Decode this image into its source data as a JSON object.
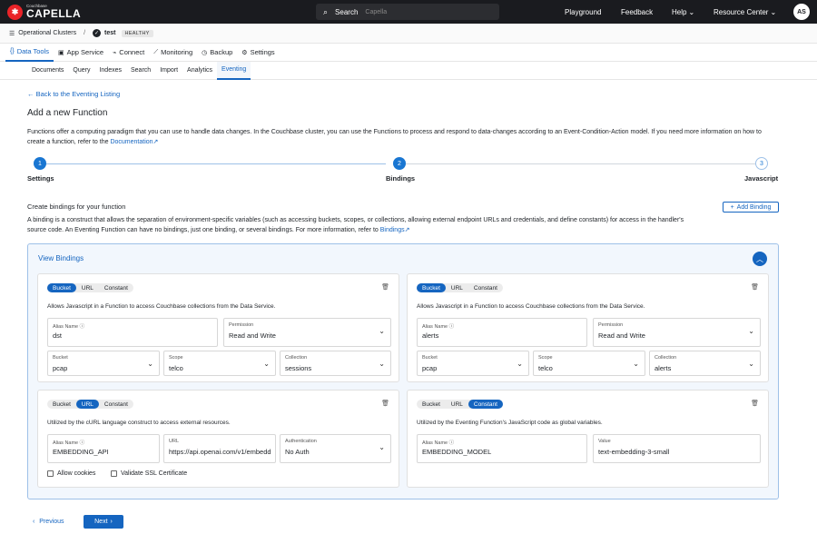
{
  "topbar": {
    "brand_small": "Couchbase",
    "brand": "CAPELLA",
    "search_label": "Search",
    "search_placeholder": "Capella",
    "nav": [
      "Playground",
      "Feedback",
      "Help",
      "Resource Center"
    ],
    "avatar": "AS"
  },
  "breadcrumb": {
    "root": "Operational Clusters",
    "separator": "/",
    "cluster": "test",
    "status": "HEALTHY"
  },
  "main_tabs": [
    "Data Tools",
    "App Service",
    "Connect",
    "Monitoring",
    "Backup",
    "Settings"
  ],
  "sub_tabs": [
    "Documents",
    "Query",
    "Indexes",
    "Search",
    "Import",
    "Analytics",
    "Eventing"
  ],
  "page": {
    "back": "Back to the Eventing Listing",
    "title": "Add a new Function",
    "intro": "Functions offer a computing paradigm that you can use to handle data changes. In the Couchbase cluster, you can use the Functions to process and respond to data-changes according to an Event-Condition-Action model. If you need more information on how to create a function, refer to the ",
    "intro_link": "Documentation"
  },
  "stepper": [
    {
      "num": "1",
      "label": "Settings"
    },
    {
      "num": "2",
      "label": "Bindings"
    },
    {
      "num": "3",
      "label": "Javascript"
    }
  ],
  "bindings": {
    "title": "Create bindings for your function",
    "add": "Add Binding",
    "desc": "A binding is a construct that allows the separation of environment-specific variables (such as accessing buckets, scopes, or collections, allowing external endpoint URLs and credentials, and define constants) for access in the handler's source code. An Eventing Function can have no bindings, just one binding, or several bindings. For more information, refer to ",
    "desc_link": "Bindings",
    "panel_title": "View Bindings",
    "seg": [
      "Bucket",
      "URL",
      "Constant"
    ],
    "bucket_desc": "Allows Javascript in a Function to access Couchbase collections from the Data Service.",
    "url_desc": "Utilized by the cURL language construct to access external resources.",
    "const_desc": "Utilized by the Eventing Function's JavaScript code as global variables.",
    "labels": {
      "alias": "Alias Name",
      "permission": "Permission",
      "bucket": "Bucket",
      "scope": "Scope",
      "collection": "Collection",
      "url": "URL",
      "auth": "Authentication",
      "value": "Value"
    },
    "b1": {
      "alias": "dst",
      "permission": "Read and Write",
      "bucket": "pcap",
      "scope": "telco",
      "collection": "sessions"
    },
    "b2": {
      "alias": "alerts",
      "permission": "Read and Write",
      "bucket": "pcap",
      "scope": "telco",
      "collection": "alerts"
    },
    "b3": {
      "alias": "EMBEDDING_API",
      "url": "https://api.openai.com/v1/embeddings",
      "auth": "No Auth",
      "allow_cookies": "Allow cookies",
      "validate_ssl": "Validate SSL Certificate"
    },
    "b4": {
      "alias": "EMBEDDING_MODEL",
      "value": "text-embedding-3-small"
    }
  },
  "footer": {
    "previous": "Previous",
    "next": "Next"
  }
}
